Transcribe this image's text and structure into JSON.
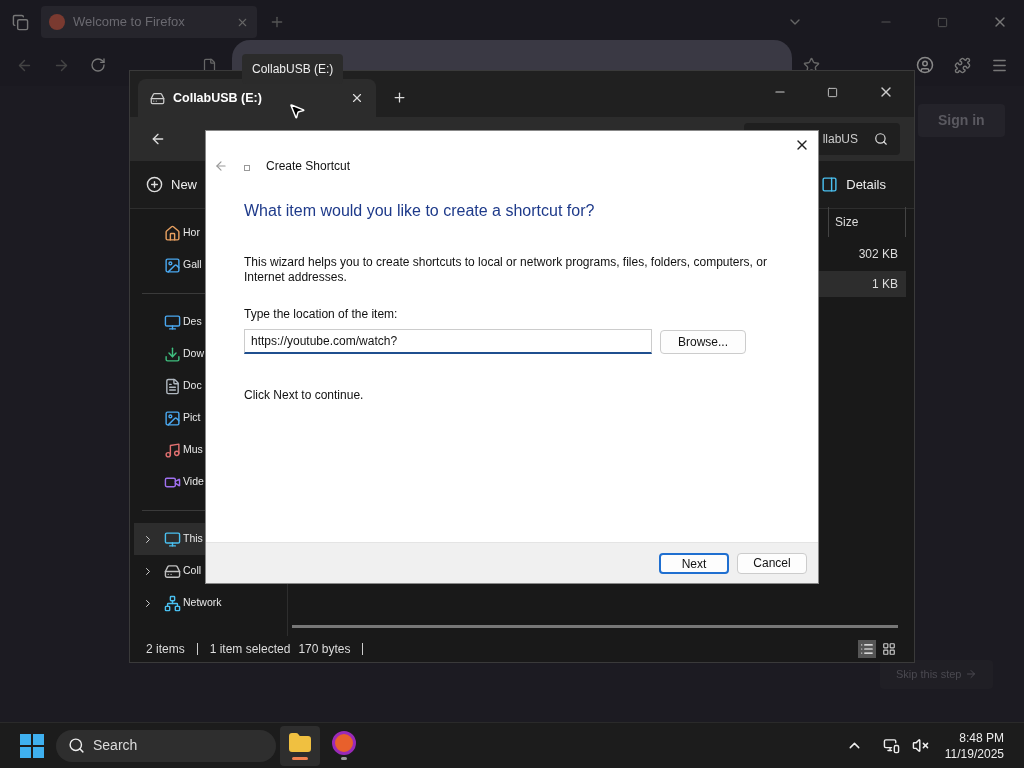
{
  "browser": {
    "tabs": [
      {
        "label": "Welcome to Firefox",
        "selected": false
      }
    ],
    "sign_in": "Sign in",
    "skip": "Skip this step"
  },
  "tooltip": "CollabUSB (E:)",
  "explorer": {
    "tabs": [
      {
        "label": "CollabUSB (E:)",
        "selected": true
      }
    ],
    "search": {
      "placeholder": "llabUS"
    },
    "new_label": "New",
    "details_label": "Details",
    "sidebar": {
      "items": [
        {
          "label": "Hor",
          "kind": "home"
        },
        {
          "label": "Gall",
          "kind": "gallery"
        },
        {
          "kind": "divider"
        },
        {
          "label": "Des",
          "kind": "desktop"
        },
        {
          "label": "Dow",
          "kind": "downloads"
        },
        {
          "label": "Doc",
          "kind": "documents"
        },
        {
          "label": "Pict",
          "kind": "pictures"
        },
        {
          "label": "Mus",
          "kind": "music"
        },
        {
          "label": "Vide",
          "kind": "videos"
        },
        {
          "kind": "divider"
        },
        {
          "label": "This",
          "kind": "pc",
          "expanded": false,
          "selected": true
        },
        {
          "label": "Coll",
          "kind": "drive",
          "expanded": false,
          "selected": false
        },
        {
          "label": "Network",
          "kind": "network",
          "expanded": false,
          "selected": false
        }
      ]
    },
    "table": {
      "columns": [
        "Size"
      ],
      "rows": [
        {
          "size": "302 KB",
          "selected": false
        },
        {
          "size": "1 KB",
          "selected": true
        }
      ]
    },
    "status_bar": [
      "2 items",
      "1 item selected",
      "170 bytes"
    ],
    "view_buttons": [
      {
        "kind": "details",
        "selected": true
      },
      {
        "kind": "tiles",
        "selected": false
      }
    ]
  },
  "dialog": {
    "title": "Create Shortcut",
    "heading": "What item would you like to create a shortcut for?",
    "description": "This wizard helps you to create shortcuts to local or network programs, files, folders, computers, or Internet addresses.",
    "field_label": "Type the location of the item:",
    "field_value": "https://youtube.com/watch?",
    "browse": "Browse...",
    "hint": "Click Next to continue.",
    "buttons": [
      {
        "label": "Next",
        "default": true
      },
      {
        "label": "Cancel",
        "default": false
      }
    ]
  },
  "taskbar": {
    "search": "Search",
    "apps": [
      {
        "kind": "explorer",
        "active": true
      },
      {
        "kind": "firefox",
        "active": false
      }
    ],
    "time": "8:48 PM",
    "date": "11/19/2025"
  }
}
